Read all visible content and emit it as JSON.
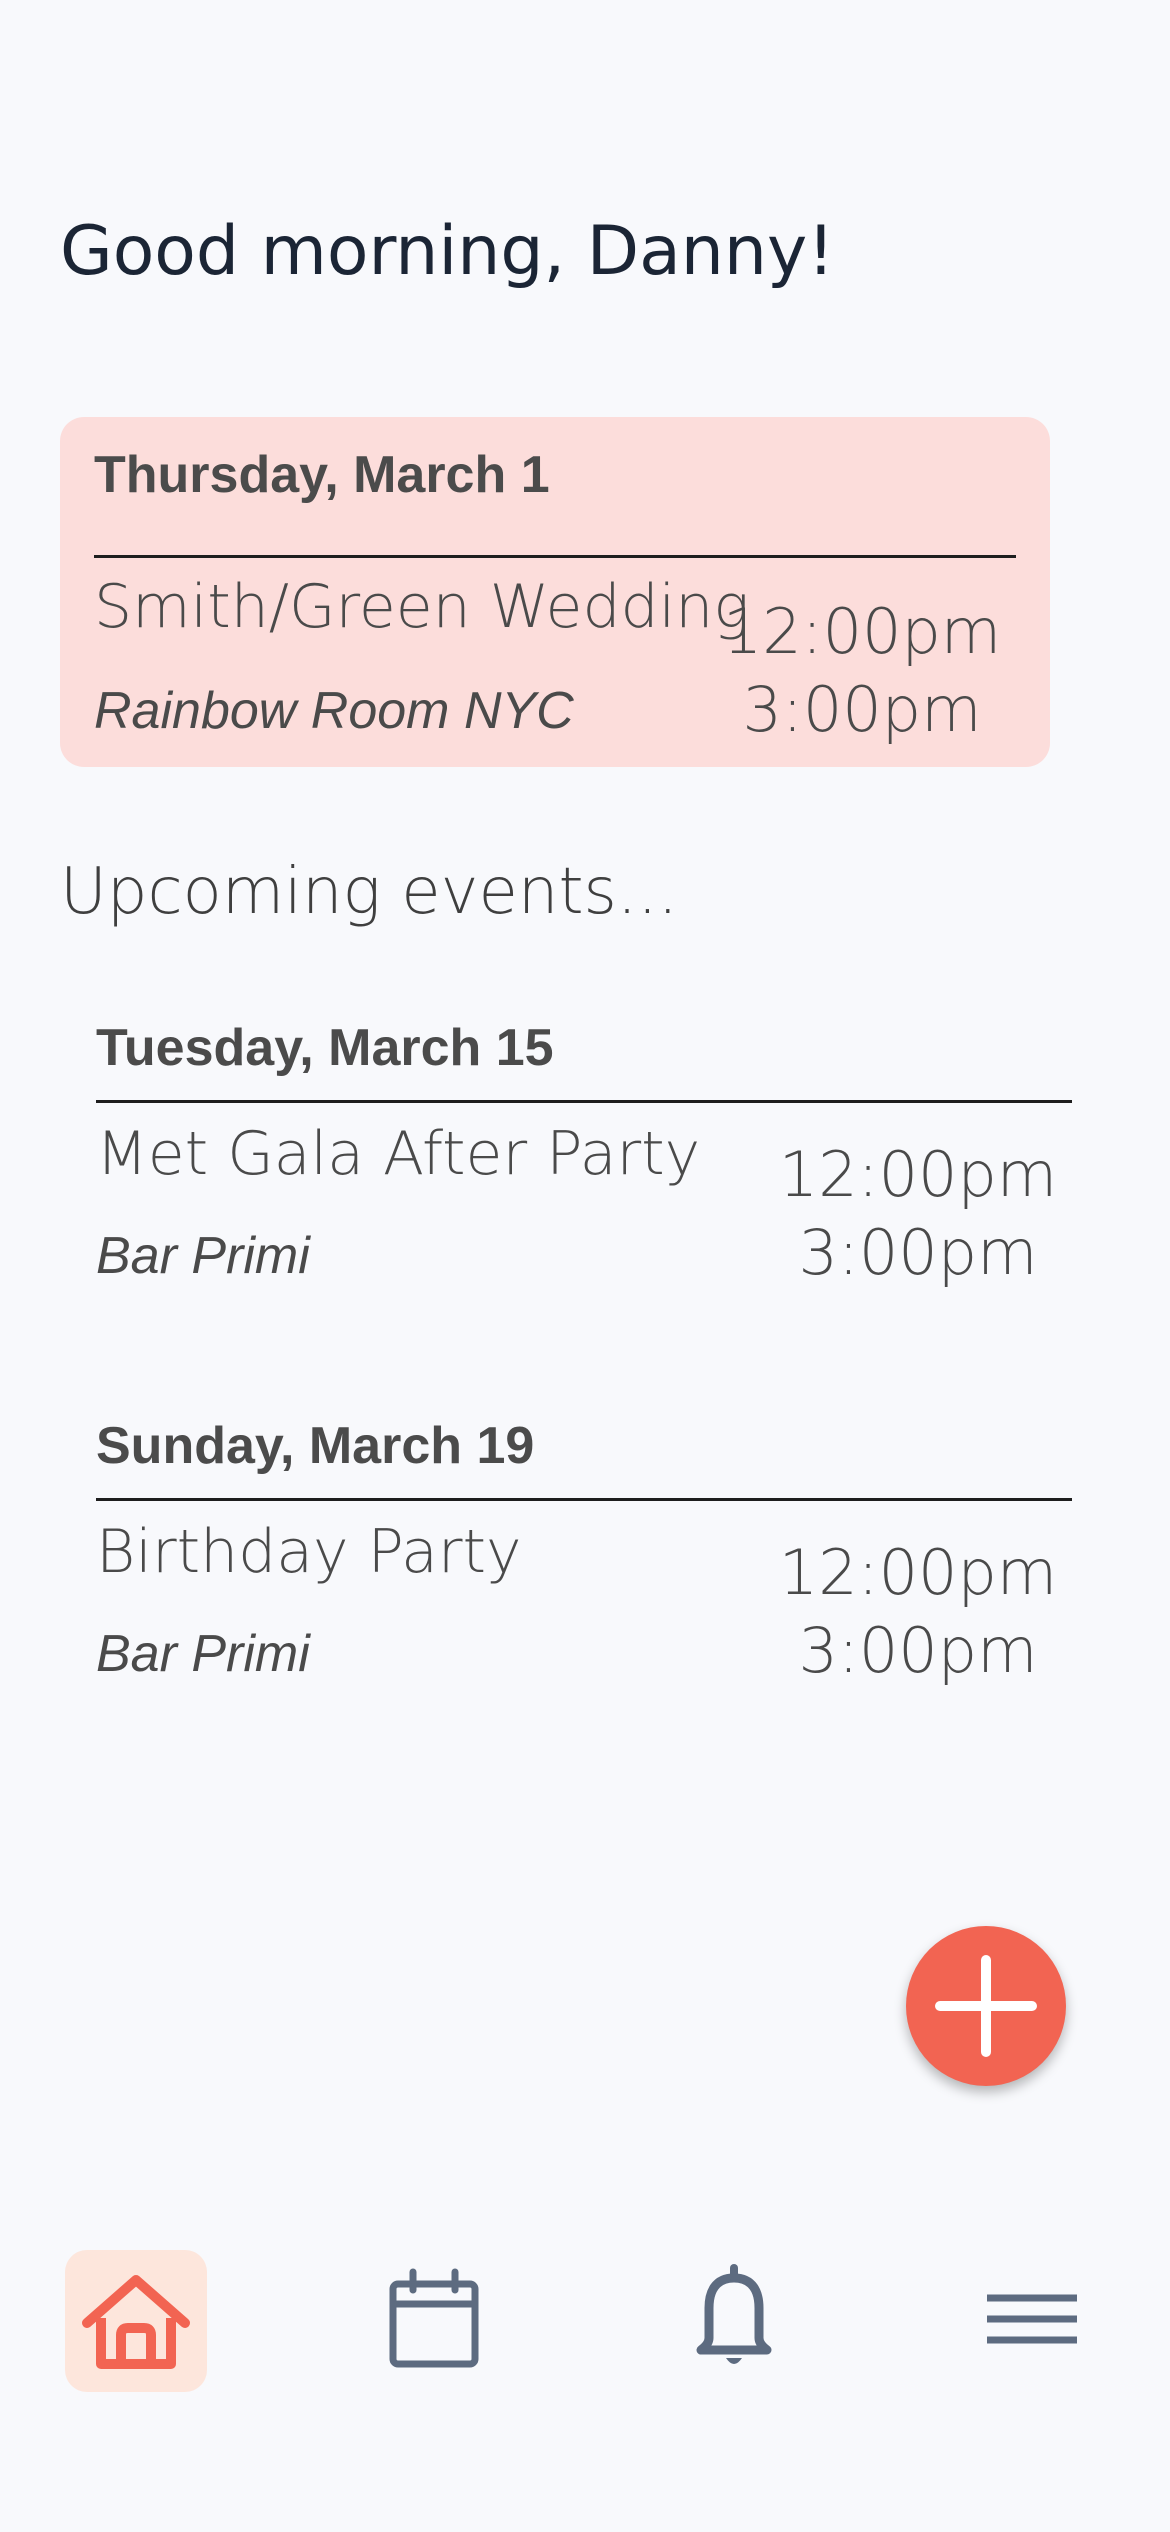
{
  "greeting": "Good morning, Danny!",
  "today": {
    "date": "Thursday, March 1",
    "title": "Smith/Green Wedding",
    "venue": "Rainbow Room NYC",
    "start": "12:00pm",
    "end": "3:00pm",
    "card_color": "#fcdddb"
  },
  "upcoming": {
    "heading": "Upcoming events...",
    "events": [
      {
        "date": "Tuesday, March 15",
        "title": "Met Gala After Party",
        "venue": "Bar Primi",
        "start": "12:00pm",
        "end": "3:00pm"
      },
      {
        "date": "Sunday, March 19",
        "title": "Birthday Party",
        "venue": "Bar Primi",
        "start": "12:00pm",
        "end": "3:00pm"
      }
    ]
  },
  "fab": {
    "icon": "plus-icon",
    "color": "#f26452"
  },
  "tabs": [
    {
      "icon": "home-icon",
      "active": true
    },
    {
      "icon": "calendar-icon",
      "active": false
    },
    {
      "icon": "bell-icon",
      "active": false
    },
    {
      "icon": "menu-icon",
      "active": false
    }
  ],
  "colors": {
    "accent": "#f26452",
    "inactive_icon": "#5d6b80",
    "background": "#f8f9fc"
  }
}
